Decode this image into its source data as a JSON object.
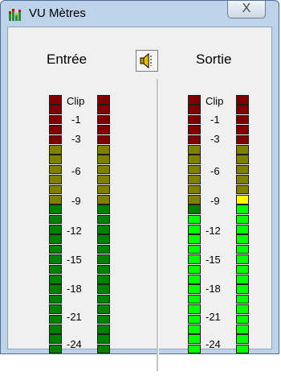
{
  "window": {
    "title": "VU Mètres",
    "close_glyph": "X"
  },
  "labels": {
    "input": "Entrée",
    "output": "Sortie"
  },
  "speaker_icon": "speaker-mute-icon",
  "scale_ticks": [
    "Clip",
    "-1",
    "-3",
    "-6",
    "-9",
    "-12",
    "-15",
    "-18",
    "-21",
    "-24"
  ],
  "meters": {
    "entree_left": {
      "lit_top_segments": 0
    },
    "entree_right": {
      "lit_top_segments": 0
    },
    "sortie_left": {
      "lit_top_segments": 14
    },
    "sortie_right": {
      "lit_top_segments": 16
    }
  },
  "colors": {
    "red_dim": "#800000",
    "olive_dim": "#808000",
    "green_dim": "#008000",
    "yellow_lit": "#ffff00",
    "green_lit": "#00ff00"
  }
}
